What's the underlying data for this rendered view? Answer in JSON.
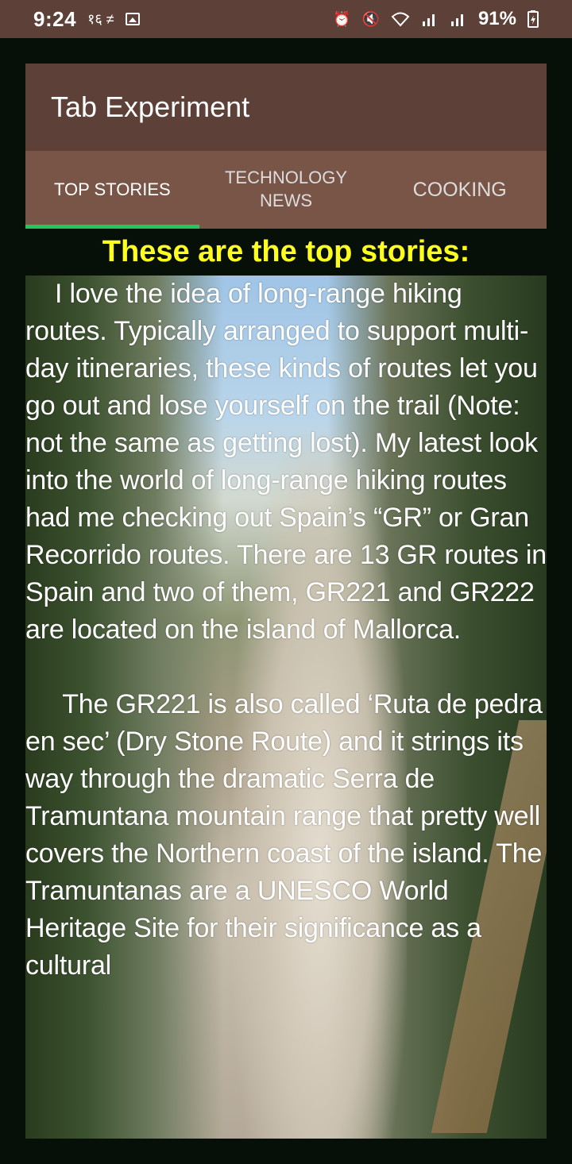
{
  "status_bar": {
    "time": "9:24",
    "left_glyphs": "१६  ≠",
    "battery": "91%",
    "icons": [
      "alarm-icon",
      "mute-icon",
      "wifi-icon",
      "signal-icon",
      "signal-icon",
      "battery-charging-icon"
    ]
  },
  "appbar": {
    "title": "Tab Experiment"
  },
  "tabs": [
    {
      "label": "TOP STORIES",
      "selected": true
    },
    {
      "label": "TECHNOLOGY NEWS",
      "selected": false
    },
    {
      "label": "COOKING",
      "selected": false
    }
  ],
  "heading": "These are the top stories:",
  "story": {
    "paragraph_1": "    I love the idea of long-range hiking routes. Typically arranged to support multi-day itineraries, these kinds of routes let you go out and lose yourself on the trail (Note: not the same as getting lost). My latest look into the world of long-range hiking routes had me checking out Spain’s “GR” or Gran Recorrido routes. There are 13 GR routes in Spain and two of them, GR221 and GR222 are located on the island of Mallorca.",
    "paragraph_2": "     The GR221 is also called ‘Ruta de pedra en sec’ (Dry Stone Route) and it strings its way through the dramatic Serra de Tramuntana mountain range that pretty well covers the Northern coast of the island. The Tramuntanas are a UNESCO World Heritage Site for their significance as a cultural"
  },
  "colors": {
    "primary": "#5d4037",
    "tab_background": "#795548",
    "indicator": "#22c55e",
    "heading": "#ffff1f",
    "background": "#061008"
  }
}
